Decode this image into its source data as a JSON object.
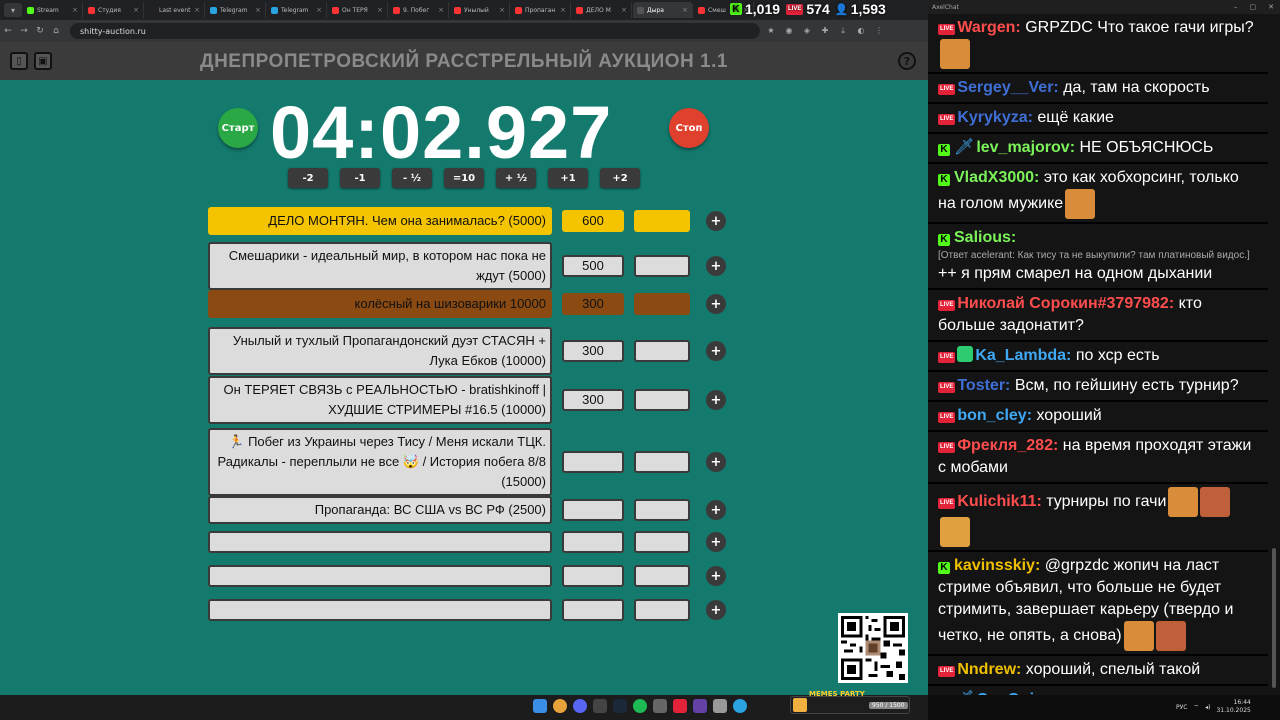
{
  "browser": {
    "tabs": [
      {
        "label": "Stream",
        "color": "#53fc18"
      },
      {
        "label": "Студия",
        "color": "#ff3333"
      },
      {
        "label": "Last event",
        "color": "#222222"
      },
      {
        "label": "Telegram",
        "color": "#2aa3e0"
      },
      {
        "label": "Telegram",
        "color": "#2aa3e0"
      },
      {
        "label": "Он ТЕРЯ",
        "color": "#ff3333"
      },
      {
        "label": "9. Побег",
        "color": "#ff3333"
      },
      {
        "label": "Унылый",
        "color": "#ff3333"
      },
      {
        "label": "Пропаган",
        "color": "#ff3333"
      },
      {
        "label": "ДЕЛО М",
        "color": "#ff3333"
      },
      {
        "label": "Дыра",
        "color": "#555555",
        "active": true
      },
      {
        "label": "Смеш",
        "color": "#ff3333"
      }
    ],
    "url": "shitty-auction.ru"
  },
  "stats": {
    "kick_count": "1,019",
    "live_count": "574",
    "viewers": "1,593"
  },
  "auction": {
    "title": "ДНЕПРОПЕТРОВСКИЙ РАССТРЕЛЬНЫЙ АУКЦИОН 1.1",
    "timer": "04:02.927",
    "start_label": "Старт",
    "stop_label": "Стоп",
    "adjust_buttons": [
      "-2",
      "-1",
      "- ½",
      "=10",
      "+ ½",
      "+1",
      "+2"
    ],
    "lots": [
      {
        "name": "ДЕЛО МОНТЯН. Чем она занималась? (5000)",
        "amount": "600",
        "style": "first"
      },
      {
        "name": "Смешарики - идеальный мир, в котором нас пока не ждут (5000)",
        "amount": "500",
        "style": "normal"
      },
      {
        "name": "колёсный на шизоварики 10000",
        "amount": "300",
        "style": "third"
      },
      {
        "name": "Унылый и тухлый Пропагандонский дуэт СТАСЯН + Лука Ебков (10000)",
        "amount": "300",
        "style": "normal"
      },
      {
        "name": "Он ТЕРЯЕТ СВЯЗЬ с РЕАЛЬНОСТЬЮ - bratishkinoff | ХУДШИЕ СТРИМЕРЫ #16.5 (10000)",
        "amount": "300",
        "style": "normal"
      },
      {
        "name": "🏃 Побег из Украины через Тису / Меня искали ТЦК. Радикалы - переплыли не все 🤯 / История побега 8/8 (15000)",
        "amount": "",
        "style": "normal"
      },
      {
        "name": "Пропаганда: ВС США vs ВС РФ (2500)",
        "amount": "",
        "style": "normal"
      },
      {
        "name": "",
        "amount": "",
        "style": "normal"
      },
      {
        "name": "",
        "amount": "",
        "style": "normal"
      },
      {
        "name": "",
        "amount": "",
        "style": "normal"
      }
    ],
    "plus_label": "+"
  },
  "taskbar": {
    "memes_title": "MEMES PARTY",
    "memes_count": "950 / 1500",
    "lang": "РУС",
    "time": "16:44",
    "date": "31.10.2025"
  },
  "chat": {
    "window_title": "AxelChat",
    "messages": [
      {
        "platform": "live",
        "user": "Wargen:",
        "user_color": "#ff4d4d",
        "text": "GRPZDC Что такое гачи игры?",
        "bold_prefix": true,
        "emotes": 1
      },
      {
        "platform": "live",
        "user": "Sergey__Ver:",
        "user_color": "#3f6fd6",
        "text": "да, там на скорость",
        "emotes": 0
      },
      {
        "platform": "live",
        "user": "Kyrykyza:",
        "user_color": "#3f6fd6",
        "text": "ещё какие",
        "emotes": 0
      },
      {
        "platform": "kick",
        "user": "lev_majorov:",
        "user_color": "#7cf25a",
        "text": "НЕ ОБЪЯСНЮСЬ",
        "sword": true,
        "emotes": 0
      },
      {
        "platform": "kick",
        "user": "VladX3000:",
        "user_color": "#7cf25a",
        "text": "это как хобхорсинг, только на голом мужике",
        "emotes": 1
      },
      {
        "platform": "kick",
        "user": "Salious:",
        "user_color": "#7cf25a",
        "reply": "[Ответ acelerant: Как тису та не выкупили? там платиновый видос.]",
        "text": "++ я прям смарел на одном дыхании",
        "emotes": 0
      },
      {
        "platform": "live",
        "user": "Николай Сорокин#3797982:",
        "user_color": "#ff4d4d",
        "text": "кто больше задонатит?",
        "emotes": 0
      },
      {
        "platform": "live",
        "user": "Ka_Lambda:",
        "user_color": "#3fa9f5",
        "text": "по хср есть",
        "shield": true,
        "emotes": 0
      },
      {
        "platform": "live",
        "user": "Toster:",
        "user_color": "#3f6fd6",
        "text": "Всм, по гейшину есть турнир?",
        "emotes": 0
      },
      {
        "platform": "live",
        "user": "bon_cley:",
        "user_color": "#3fa9f5",
        "text": "хороший",
        "emotes": 0
      },
      {
        "platform": "live",
        "user": "Фрекля_282:",
        "user_color": "#ff4d4d",
        "text": "на время проходят этажи с мобами",
        "emotes": 0
      },
      {
        "platform": "live",
        "user": "Kulichik11:",
        "user_color": "#ff4d4d",
        "text": "турниры по гачи",
        "emotes": 3
      },
      {
        "platform": "kick",
        "user": "kavinsskiy:",
        "user_color": "#f0c000",
        "text": "@grpzdc жопич на ласт стриме объявил, что больше не будет стримить, завершает карьеру (твердо и четко, не опять, а снова)",
        "emotes": 2
      },
      {
        "platform": "live",
        "user": "Nndrew:",
        "user_color": "#f0c000",
        "text": "хороший, спелый такой",
        "emotes": 0
      },
      {
        "platform": "kick",
        "user": "QueQuiero:",
        "user_color": "#3fa9f5",
        "text": "сча",
        "sword": true,
        "emotes": 0
      }
    ]
  }
}
